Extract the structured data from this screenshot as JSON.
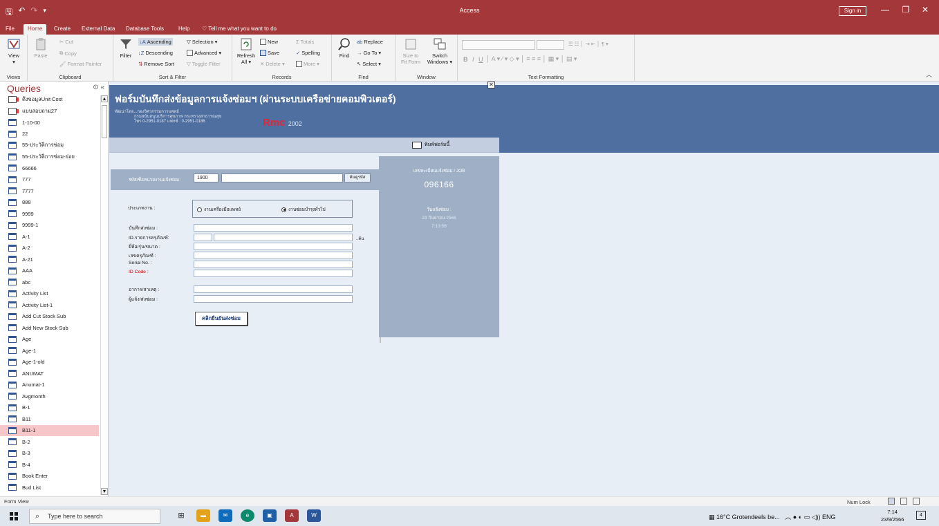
{
  "titlebar": {
    "app_title": "Access",
    "sign_in": "Sign in",
    "minimize": "—",
    "restore": "❐",
    "close": "✕"
  },
  "tabs": [
    "File",
    "Home",
    "Create",
    "External Data",
    "Database Tools",
    "Help"
  ],
  "tell_me": "Tell me what you want to do",
  "ribbon": {
    "views": {
      "view": "View",
      "label": "Views"
    },
    "clipboard": {
      "paste": "Paste",
      "cut": "Cut",
      "copy": "Copy",
      "format_painter": "Format Painter",
      "label": "Clipboard"
    },
    "sort_filter": {
      "filter": "Filter",
      "ascending": "Ascending",
      "descending": "Descending",
      "remove_sort": "Remove Sort",
      "selection": "Selection",
      "advanced": "Advanced",
      "toggle_filter": "Toggle Filter",
      "label": "Sort & Filter"
    },
    "records": {
      "refresh": "Refresh",
      "all": "All",
      "new": "New",
      "save": "Save",
      "delete": "Delete",
      "totals": "Totals",
      "spelling": "Spelling",
      "more": "More",
      "label": "Records"
    },
    "find": {
      "find": "Find",
      "replace": "Replace",
      "goto": "Go To",
      "select": "Select",
      "label": "Find"
    },
    "window": {
      "size_to": "Size to",
      "fit_form": "Fit Form",
      "switch": "Switch",
      "windows": "Windows",
      "label": "Window"
    },
    "text_formatting": {
      "label": "Text Formatting"
    }
  },
  "nav": {
    "title": "Queries",
    "items": [
      {
        "label": "ดึงขอมูลUnit Cost",
        "icon": "query",
        "selected": false
      },
      {
        "label": "แบบสอบถาม27",
        "icon": "query",
        "selected": false
      },
      {
        "label": "1-10-00",
        "icon": "table",
        "selected": false
      },
      {
        "label": "22",
        "icon": "table",
        "selected": false
      },
      {
        "label": "55-ประวัติการซ่อม",
        "icon": "table",
        "selected": false
      },
      {
        "label": "55-ประวัติการซ่อม-ย่อย",
        "icon": "table",
        "selected": false
      },
      {
        "label": "66666",
        "icon": "table",
        "selected": false
      },
      {
        "label": "777",
        "icon": "table",
        "selected": false
      },
      {
        "label": "7777",
        "icon": "table",
        "selected": false
      },
      {
        "label": "888",
        "icon": "table",
        "selected": false
      },
      {
        "label": "9999",
        "icon": "table",
        "selected": false
      },
      {
        "label": "9999-1",
        "icon": "table",
        "selected": false
      },
      {
        "label": "A-1",
        "icon": "table",
        "selected": false
      },
      {
        "label": "A-2",
        "icon": "table",
        "selected": false
      },
      {
        "label": "A-21",
        "icon": "table",
        "selected": false
      },
      {
        "label": "AAA",
        "icon": "table",
        "selected": false
      },
      {
        "label": "abc",
        "icon": "table",
        "selected": false
      },
      {
        "label": "Activity List",
        "icon": "table",
        "selected": false
      },
      {
        "label": "Activity List-1",
        "icon": "table",
        "selected": false
      },
      {
        "label": "Add Cut Stock Sub",
        "icon": "table",
        "selected": false
      },
      {
        "label": "Add New Stock Sub",
        "icon": "table",
        "selected": false
      },
      {
        "label": "Age",
        "icon": "table",
        "selected": false
      },
      {
        "label": "Age-1",
        "icon": "table",
        "selected": false
      },
      {
        "label": "Age-1-old",
        "icon": "table",
        "selected": false
      },
      {
        "label": "ANUMAT",
        "icon": "table",
        "selected": false
      },
      {
        "label": "Anumat-1",
        "icon": "table",
        "selected": false
      },
      {
        "label": "Avgmonth",
        "icon": "table",
        "selected": false
      },
      {
        "label": "B-1",
        "icon": "table",
        "selected": false
      },
      {
        "label": "B11",
        "icon": "table",
        "selected": false
      },
      {
        "label": "B11-1",
        "icon": "table",
        "selected": true
      },
      {
        "label": "B-2",
        "icon": "table",
        "selected": false
      },
      {
        "label": "B-3",
        "icon": "table",
        "selected": false
      },
      {
        "label": "B-4",
        "icon": "table",
        "selected": false
      },
      {
        "label": "Book Enter",
        "icon": "table",
        "selected": false
      },
      {
        "label": "Bud List",
        "icon": "table",
        "selected": false
      }
    ]
  },
  "form": {
    "title": "ฟอร์มบันทึกส่งข้อมูลการแจ้งซ่อมฯ (ผ่านระบบเครือข่ายคอมพิวเตอร์)",
    "sub1": "พัฒนาโดย...กองวิศวกรรมการแพทย์",
    "sub2": "กรมสนับสนุนบริการสุขภาพ กระทรวงสาธารณสุข",
    "sub3": "โทร.0-2951-0187 แฟกซ์ : 0-2951-0186",
    "logo_main": "Rmc",
    "logo_year": "2002",
    "print_label": "พิมพ์ฟอร์มนี้",
    "unit_label": "รหัส/ชื่อหน่วยงานแจ้งซ่อม:",
    "unit_code": "1900",
    "unit_search": "ค้นดูรหัส",
    "job_label": "เลขทะเบียนแจ้งซ่อม / JOB",
    "job_number": "096166",
    "date_label": "วันแจ้งซ่อม :",
    "date_value": "23 กันยายน 2566",
    "time_value": "7:13:58",
    "worktype_label": "ประเภทงาน :",
    "worktype_opt1": "งานเครื่องมือแพทย์",
    "worktype_opt2": "งานซ่อมบำรุงทั่วไป",
    "fields": {
      "sender": "บันทึกส่งซ่อม :",
      "id_item": "ID-รายการครุภัณฑ์:",
      "brand": "ยี่ห้อ/รุ่น/ขนาด :",
      "asset_no": "เลขครุภัณฑ์ :",
      "serial": "Serial No. :",
      "id_code": "ID Code :",
      "symptom": "อาการ/สาเหตุ :",
      "reporter": "ผู้แจ้ง/ส่งซ่อม :"
    },
    "id_search": "..ค้น",
    "submit": "คลิกยืนยันส่งซ่อม"
  },
  "status": {
    "left": "Form View",
    "numlock": "Num Lock"
  },
  "taskbar": {
    "search_placeholder": "Type here to search",
    "weather": "16°C Grotendeels be...",
    "lang": "ENG",
    "time": "7:14",
    "date": "23/9/2566",
    "notifications": "4"
  },
  "colors": {
    "accent": "#a4373a",
    "header_blue": "#4e6fa0",
    "panel_blue": "#9fb0c6",
    "form_bg": "#e8eef6"
  }
}
